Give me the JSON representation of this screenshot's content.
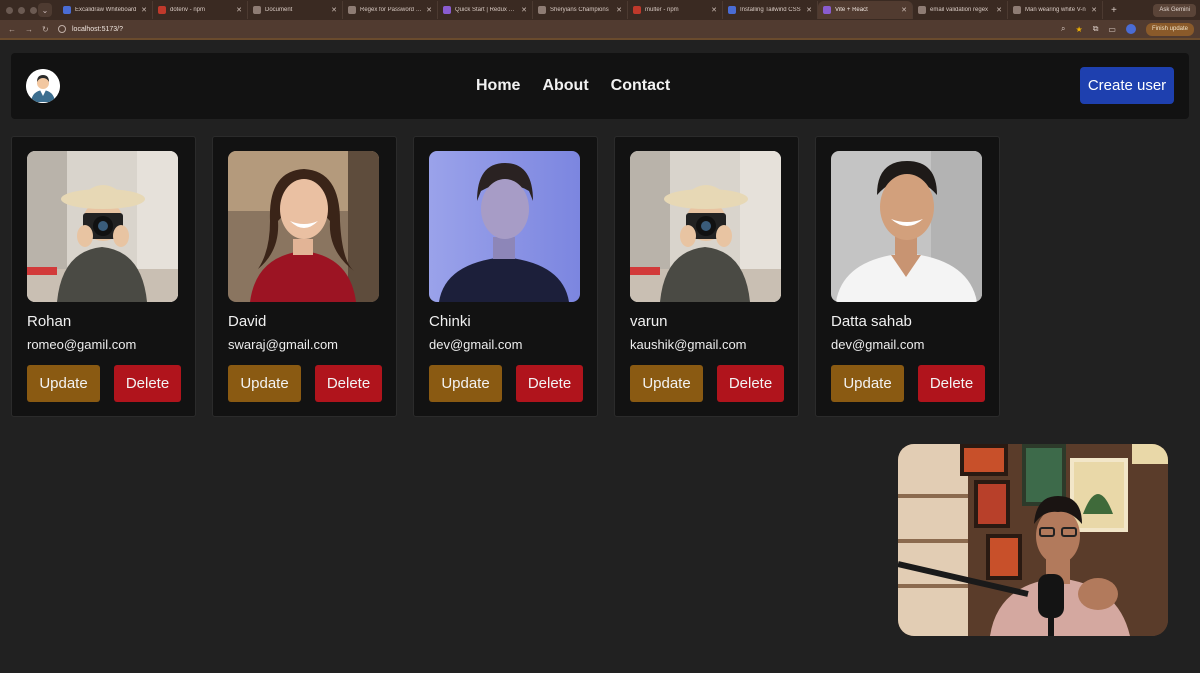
{
  "browser": {
    "tabs": [
      {
        "title": "Excalidraw Whiteboard",
        "active": false
      },
      {
        "title": "dotenv - npm",
        "active": false
      },
      {
        "title": "Document",
        "active": false
      },
      {
        "title": "Regex for Password Va",
        "active": false
      },
      {
        "title": "Quick Start | Redux Too",
        "active": false
      },
      {
        "title": "Sheryians Champions",
        "active": false
      },
      {
        "title": "multer - npm",
        "active": false
      },
      {
        "title": "Installing Tailwind CSS",
        "active": false
      },
      {
        "title": "Vite + React",
        "active": true
      },
      {
        "title": "email validation regex",
        "active": false
      },
      {
        "title": "Man wearing white V-n",
        "active": false
      }
    ],
    "ask_gemini": "Ask Gemini",
    "url": "localhost:5173/?",
    "finish_update": "Finish update"
  },
  "nav": {
    "links": [
      "Home",
      "About",
      "Contact"
    ],
    "create_label": "Create user"
  },
  "users": [
    {
      "name": "Rohan",
      "email": "romeo@gamil.com",
      "update": "Update",
      "delete": "Delete"
    },
    {
      "name": "David",
      "email": "swaraj@gmail.com",
      "update": "Update",
      "delete": "Delete"
    },
    {
      "name": "Chinki",
      "email": "dev@gmail.com",
      "update": "Update",
      "delete": "Delete"
    },
    {
      "name": "varun",
      "email": "kaushik@gmail.com",
      "update": "Update",
      "delete": "Delete"
    },
    {
      "name": "Datta sahab",
      "email": "dev@gmail.com",
      "update": "Update",
      "delete": "Delete"
    }
  ],
  "colors": {
    "background": "#212121",
    "panel": "#121212",
    "create_button": "#1e40af",
    "update_button": "#8a5a12",
    "delete_button": "#b0141c"
  }
}
